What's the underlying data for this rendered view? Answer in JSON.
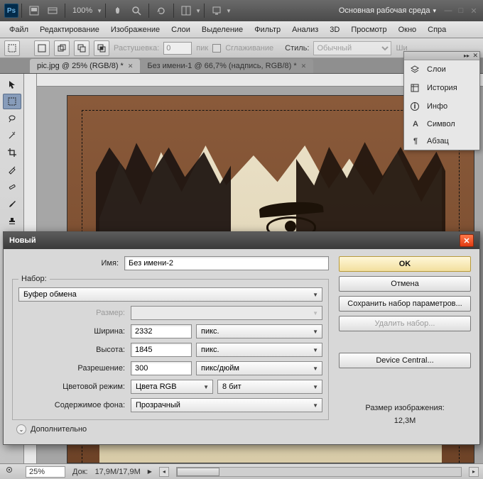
{
  "app": {
    "zoom_app_menu": "100%",
    "workspace_label": "Основная рабочая среда",
    "workspace_caret": "▾"
  },
  "menu": {
    "file": "Файл",
    "edit": "Редактирование",
    "image": "Изображение",
    "layers": "Слои",
    "select": "Выделение",
    "filter": "Фильтр",
    "analysis": "Анализ",
    "threeD": "3D",
    "view": "Просмотр",
    "window": "Окно",
    "help": "Спра"
  },
  "options": {
    "feather_label": "Растушевка:",
    "feather_value": "0",
    "feather_unit": "пик",
    "antialias_label": "Сглаживание",
    "style_label": "Стиль:",
    "style_value": "Обычный",
    "width_label_abbr": "Ши"
  },
  "tabs": {
    "t1": "pic.jpg @ 25% (RGB/8) *",
    "t2": "Без имени-1 @ 66,7% (надпись, RGB/8) *"
  },
  "panels": {
    "layers": "Слои",
    "history": "История",
    "info": "Инфо",
    "character": "Символ",
    "paragraph": "Абзац"
  },
  "status": {
    "zoom": "25%",
    "doc_label": "Док:",
    "doc_value": "17,9M/17,9M"
  },
  "dialog": {
    "title": "Новый",
    "name_label": "Имя:",
    "name_value": "Без имени-2",
    "preset_label": "Набор:",
    "preset_value": "Буфер обмена",
    "size_label": "Размер:",
    "size_value": "",
    "width_label": "Ширина:",
    "width_value": "2332",
    "width_unit": "пикс.",
    "height_label": "Высота:",
    "height_value": "1845",
    "height_unit": "пикс.",
    "res_label": "Разрешение:",
    "res_value": "300",
    "res_unit": "пикс/дюйм",
    "mode_label": "Цветовой режим:",
    "mode_value": "Цвета RGB",
    "depth_value": "8 бит",
    "bg_label": "Содержимое фона:",
    "bg_value": "Прозрачный",
    "advanced": "Дополнительно",
    "btn_ok": "OK",
    "btn_cancel": "Отмена",
    "btn_save_preset": "Сохранить набор параметров...",
    "btn_delete_preset": "Удалить набор...",
    "btn_device_central": "Device Central...",
    "size_info_label": "Размер изображения:",
    "size_info_value": "12,3M"
  }
}
